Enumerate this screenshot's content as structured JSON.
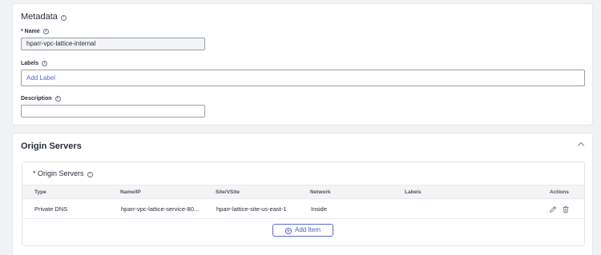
{
  "metadata": {
    "title": "Metadata",
    "name_label": "* Name",
    "name_value": "hparr-vpc-lattice-internal",
    "labels_label": "Labels",
    "labels_placeholder": "Add Label",
    "description_label": "Description",
    "description_value": ""
  },
  "origin": {
    "title": "Origin Servers",
    "inner_title": "*  Origin Servers",
    "columns": [
      "Type",
      "Name/IP",
      "Site/VSite",
      "Network",
      "Labels",
      "Actions"
    ],
    "rows": [
      {
        "type": "Private DNS",
        "name_ip": "hparr-vpc-lattice-service-80...",
        "site": "hparr-lattice-site-us-east-1",
        "network": "Inside",
        "labels": ""
      }
    ],
    "add_item_label": "Add Item"
  },
  "icons": {
    "info": "info-icon",
    "collapse": "chevron-up-icon",
    "edit": "pencil-icon",
    "delete": "trash-icon",
    "add": "plus-circle-icon"
  },
  "colors": {
    "accent": "#5b6ad0",
    "background": "#f1f2f4"
  }
}
